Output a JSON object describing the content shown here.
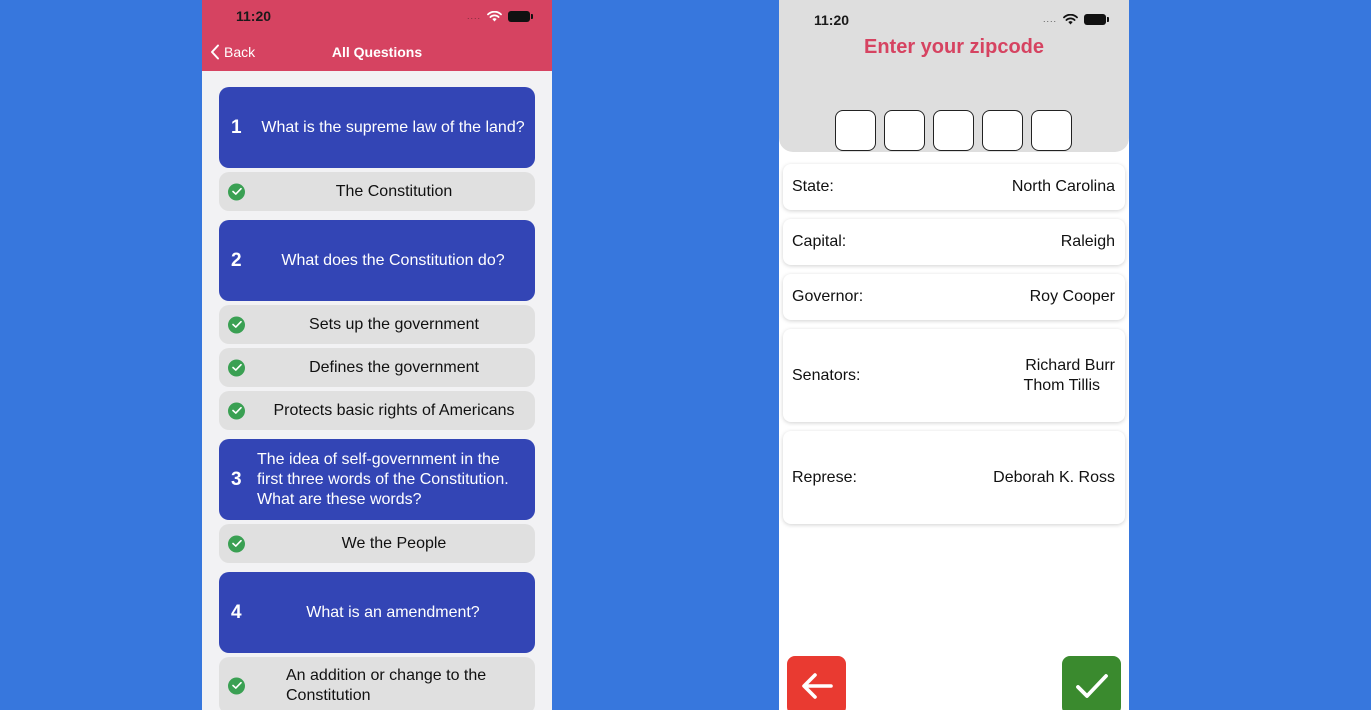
{
  "left_phone": {
    "status_time": "11:20",
    "nav": {
      "back_label": "Back",
      "title": "All Questions"
    },
    "questions": [
      {
        "number": "1",
        "text": "What is the supreme law of the land?",
        "answers": [
          "The Constitution"
        ]
      },
      {
        "number": "2",
        "text": "What does the Constitution do?",
        "answers": [
          "Sets up the government",
          "Defines the government",
          "Protects basic rights of Americans"
        ]
      },
      {
        "number": "3",
        "text": "The idea of self-government in the first three words of the Constitution. What are these words?",
        "answers": [
          "We the People"
        ]
      },
      {
        "number": "4",
        "text": "What is an amendment?",
        "answers": [
          "An addition or change to the Constitution"
        ]
      }
    ]
  },
  "right_phone": {
    "status_time": "11:20",
    "zip_title": "Enter your zipcode",
    "zip_digits": [
      "",
      "",
      "",
      "",
      ""
    ],
    "info": {
      "state_label": "State:",
      "state_value": "North Carolina",
      "capital_label": "Capital:",
      "capital_value": "Raleigh",
      "governor_label": "Governor:",
      "governor_value": "Roy Cooper",
      "senators_label": "Senators:",
      "senators_values": [
        "Richard Burr",
        "Thom Tillis"
      ],
      "rep_label": "Represe:",
      "rep_value": "Deborah K. Ross"
    }
  },
  "colors": {
    "background": "#3777dd",
    "header_red": "#d64361",
    "question_blue": "#3345b5",
    "check_green": "#3aa053",
    "back_red": "#e93a31",
    "confirm_green": "#3a8a2e"
  },
  "icons": {
    "back": "chevron-left-icon",
    "check": "checkmark-circle-icon",
    "wifi": "wifi-icon",
    "battery": "battery-icon",
    "arrow_left": "arrow-left-icon",
    "confirm": "checkmark-icon"
  }
}
